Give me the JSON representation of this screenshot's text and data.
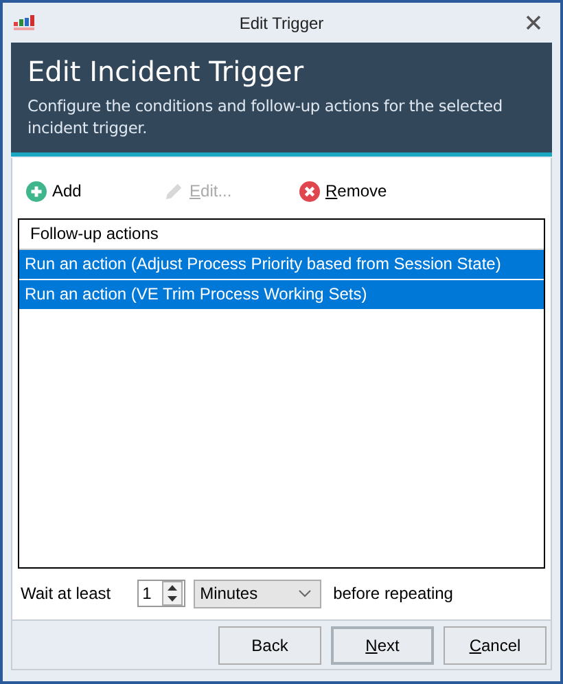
{
  "window": {
    "title": "Edit Trigger"
  },
  "header": {
    "title": "Edit Incident Trigger",
    "description": "Configure the conditions and follow-up actions for the selected incident trigger."
  },
  "toolbar": [
    {
      "kind": "add",
      "label": "Add",
      "disabled": false,
      "underline_first": false
    },
    {
      "kind": "edit",
      "label": "Edit...",
      "disabled": true,
      "underline_first": true
    },
    {
      "kind": "remove",
      "label": "Remove",
      "disabled": false,
      "underline_first": true
    }
  ],
  "list": {
    "column": "Follow-up actions",
    "rows": [
      {
        "text": "Run an action (Adjust Process Priority based from Session State)",
        "selected": true
      },
      {
        "text": "Run an action (VE Trim Process Working Sets)",
        "selected": true
      }
    ]
  },
  "repeat": {
    "label": "Wait at least",
    "value": "1",
    "unit": "Minutes",
    "suffix": "before repeating"
  },
  "buttons": [
    {
      "label": "Back",
      "default": false,
      "underline_first": false
    },
    {
      "label": "Next",
      "default": true,
      "underline_first": true
    },
    {
      "label": "Cancel",
      "default": false,
      "underline_first": true
    }
  ]
}
